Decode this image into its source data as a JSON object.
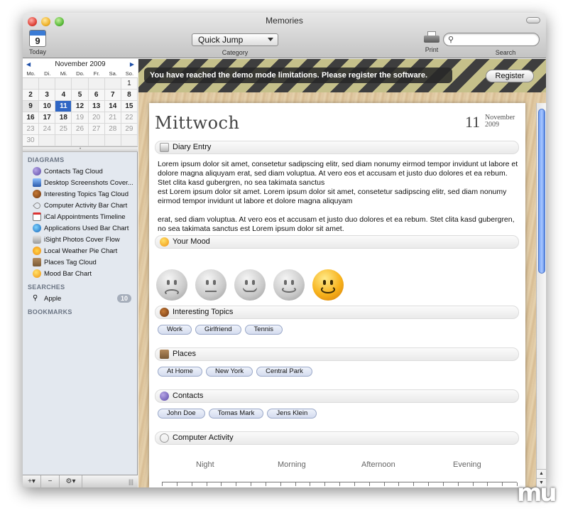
{
  "window": {
    "title": "Memories"
  },
  "toolbar": {
    "today_label": "Today",
    "today_icon_num": "9",
    "category_select": "Quick Jump",
    "category_label": "Category",
    "print_label": "Print",
    "search_label": "Search",
    "search_value": ""
  },
  "mini_calendar": {
    "month": "November 2009",
    "weekdays": [
      "Mo.",
      "Di.",
      "Mi.",
      "Do.",
      "Fr.",
      "Sa.",
      "So."
    ],
    "weeks": [
      [
        "",
        "",
        "",
        "",
        "",
        "",
        "1"
      ],
      [
        "2",
        "3",
        "4",
        "5",
        "6",
        "7",
        "8"
      ],
      [
        "9",
        "10",
        "11",
        "12",
        "13",
        "14",
        "15"
      ],
      [
        "16",
        "17",
        "18",
        "19",
        "20",
        "21",
        "22"
      ],
      [
        "23",
        "24",
        "25",
        "26",
        "27",
        "28",
        "29"
      ],
      [
        "30",
        "",
        "",
        "",
        "",
        "",
        ""
      ]
    ],
    "selected": "11",
    "current": "9"
  },
  "sidebar": {
    "diagrams_header": "DIAGRAMS",
    "diagrams": [
      {
        "label": "Contacts Tag Cloud",
        "icon": "contacts-icon"
      },
      {
        "label": "Desktop Screenshots Cover...",
        "icon": "screenshot-icon"
      },
      {
        "label": "Interesting Topics Tag Cloud",
        "icon": "topics-icon"
      },
      {
        "label": "Computer Activity Bar Chart",
        "icon": "activity-icon"
      },
      {
        "label": "iCal Appointments Timeline",
        "icon": "ical-icon"
      },
      {
        "label": "Applications Used Bar Chart",
        "icon": "apps-icon"
      },
      {
        "label": "iSight Photos Cover Flow",
        "icon": "isight-icon"
      },
      {
        "label": "Local Weather Pie Chart",
        "icon": "weather-icon"
      },
      {
        "label": "Places Tag Cloud",
        "icon": "places-icon"
      },
      {
        "label": "Mood Bar Chart",
        "icon": "mood-icon"
      }
    ],
    "searches_header": "SEARCHES",
    "searches": [
      {
        "label": "Apple",
        "count": "10"
      }
    ],
    "bookmarks_header": "BOOKMARKS"
  },
  "banner": {
    "message": "You have reached the demo mode limitations. Please register the software.",
    "register_label": "Register"
  },
  "entry": {
    "day_name": "Mittwoch",
    "day_number": "11",
    "month": "November",
    "year": "2009",
    "diary_header": "Diary Entry",
    "diary_text": "Lorem ipsum dolor sit amet, consetetur sadipscing elitr, sed diam nonumy eirmod tempor invidunt ut labore et dolore magna aliquyam erat, sed diam voluptua. At vero eos et accusam et justo duo dolores et ea rebum. Stet clita kasd gubergren, no sea takimata sanctus\nest Lorem ipsum dolor sit amet. Lorem ipsum dolor sit amet, consetetur sadipscing elitr, sed diam nonumy eirmod tempor invidunt ut labore et dolore magna aliquyam\n\nerat, sed diam voluptua. At vero eos et accusam et justo duo dolores et ea rebum. Stet clita kasd gubergren, no sea takimata sanctus est Lorem ipsum dolor sit amet.",
    "mood_header": "Your Mood",
    "mood_selected": 5,
    "topics_header": "Interesting Topics",
    "topics": [
      "Work",
      "Girlfriend",
      "Tennis"
    ],
    "places_header": "Places",
    "places": [
      "At Home",
      "New York",
      "Central Park"
    ],
    "contacts_header": "Contacts",
    "contacts": [
      "John Doe",
      "Tomas Mark",
      "Jens Klein"
    ],
    "activity_header": "Computer Activity",
    "activity_periods": [
      "Night",
      "Morning",
      "Afternoon",
      "Evening"
    ]
  },
  "colors": {
    "selection": "#2f66c4",
    "banner_dark": "#3e3e3e",
    "banner_stripe": "#c5c08a"
  }
}
